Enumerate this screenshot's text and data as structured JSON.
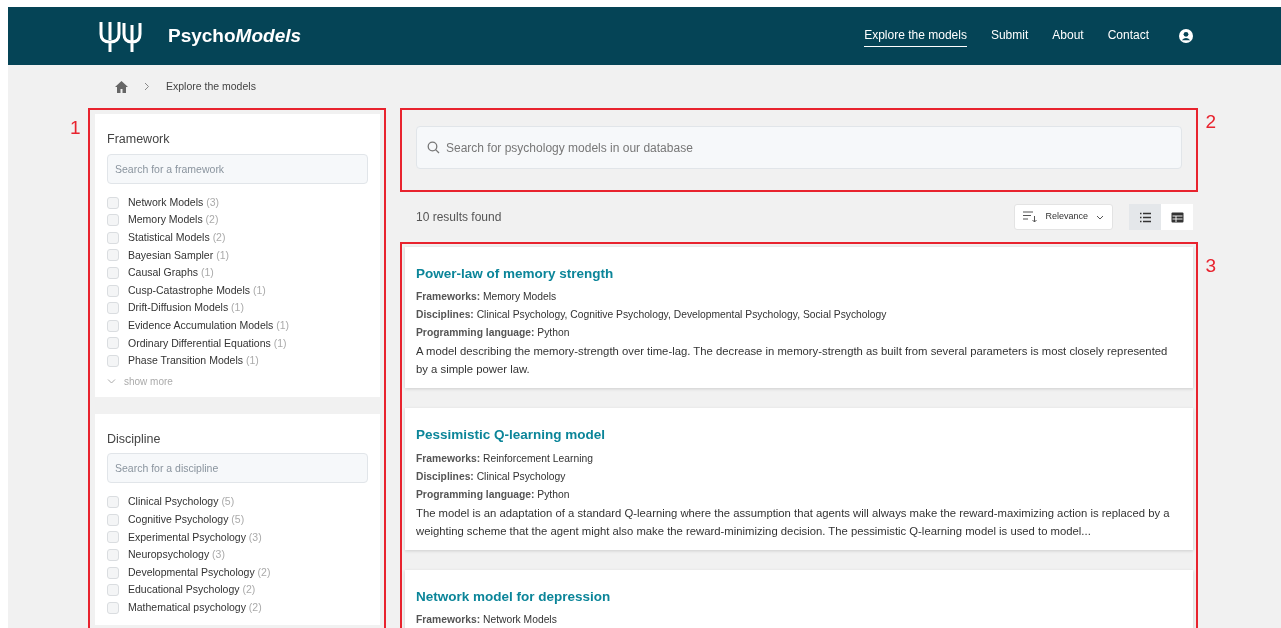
{
  "navbar": {
    "brand_bold": "Psycho",
    "brand_italic": "Models",
    "links": [
      {
        "label": "Explore the models",
        "selected": true
      },
      {
        "label": "Submit",
        "selected": false
      },
      {
        "label": "About",
        "selected": false
      },
      {
        "label": "Contact",
        "selected": false
      }
    ]
  },
  "breadcrumb": [
    "Explore the models"
  ],
  "filters": [
    {
      "title": "Framework",
      "placeholder": "Search for a framework",
      "options": [
        {
          "label": "Network Models",
          "count": "(3)",
          "checked": false
        },
        {
          "label": "Memory Models",
          "count": "(2)",
          "checked": false
        },
        {
          "label": "Statistical Models",
          "count": "(2)",
          "checked": false
        },
        {
          "label": "Bayesian Sampler",
          "count": "(1)",
          "checked": false
        },
        {
          "label": "Causal Graphs",
          "count": "(1)",
          "checked": false
        },
        {
          "label": "Cusp-Catastrophe Models",
          "count": "(1)",
          "checked": false
        },
        {
          "label": "Drift-Diffusion Models",
          "count": "(1)",
          "checked": false
        },
        {
          "label": "Evidence Accumulation Models",
          "count": "(1)",
          "checked": false
        },
        {
          "label": "Ordinary Differential Equations",
          "count": "(1)",
          "checked": false
        },
        {
          "label": "Phase Transition Models",
          "count": "(1)",
          "checked": false
        }
      ],
      "show_more": "show more"
    },
    {
      "title": "Discipline",
      "placeholder": "Search for a discipline",
      "options": [
        {
          "label": "Clinical Psychology",
          "count": "(5)",
          "checked": false
        },
        {
          "label": "Cognitive Psychology",
          "count": "(5)",
          "checked": false
        },
        {
          "label": "Experimental Psychology",
          "count": "(3)",
          "checked": false
        },
        {
          "label": "Neuropsychology",
          "count": "(3)",
          "checked": false
        },
        {
          "label": "Developmental Psychology",
          "count": "(2)",
          "checked": false
        },
        {
          "label": "Educational Psychology",
          "count": "(2)",
          "checked": false
        },
        {
          "label": "Mathematical psychology",
          "count": "(2)",
          "checked": false
        }
      ]
    }
  ],
  "search": {
    "placeholder": "Search for psychology models in our database"
  },
  "results_count": "10 results found",
  "sort": {
    "label": "Relevance"
  },
  "view_toggle": [
    {
      "kind": "list",
      "selected": true
    },
    {
      "kind": "table",
      "selected": false
    }
  ],
  "results": [
    {
      "title": "Power-law of memory strength",
      "fields": [
        {
          "label": "Frameworks:",
          "value": "Memory Models"
        },
        {
          "label": "Disciplines:",
          "value": "Clinical Psychology, Cognitive Psychology, Developmental Psychology, Social Psychology"
        },
        {
          "label": "Programming language:",
          "value": "Python"
        }
      ],
      "description": "A model describing the memory-strength over time-lag. The decrease in memory-strength as built from several parameters is most closely represented by a simple power law."
    },
    {
      "title": "Pessimistic Q-learning model",
      "fields": [
        {
          "label": "Frameworks:",
          "value": "Reinforcement Learning"
        },
        {
          "label": "Disciplines:",
          "value": "Clinical Psychology"
        },
        {
          "label": "Programming language:",
          "value": "Python"
        }
      ],
      "description": "The model is an adaptation of a standard Q-learning where the assumption that agents will always make the reward-maximizing action is replaced by a weighting scheme that the agent might also make the reward-minimizing decision. The pessimistic Q-learning model is used to model..."
    },
    {
      "title": "Network model for depression",
      "fields": [
        {
          "label": "Frameworks:",
          "value": "Network Models"
        }
      ]
    }
  ],
  "annotations": [
    {
      "label": "1"
    },
    {
      "label": "2"
    },
    {
      "label": "3"
    }
  ]
}
